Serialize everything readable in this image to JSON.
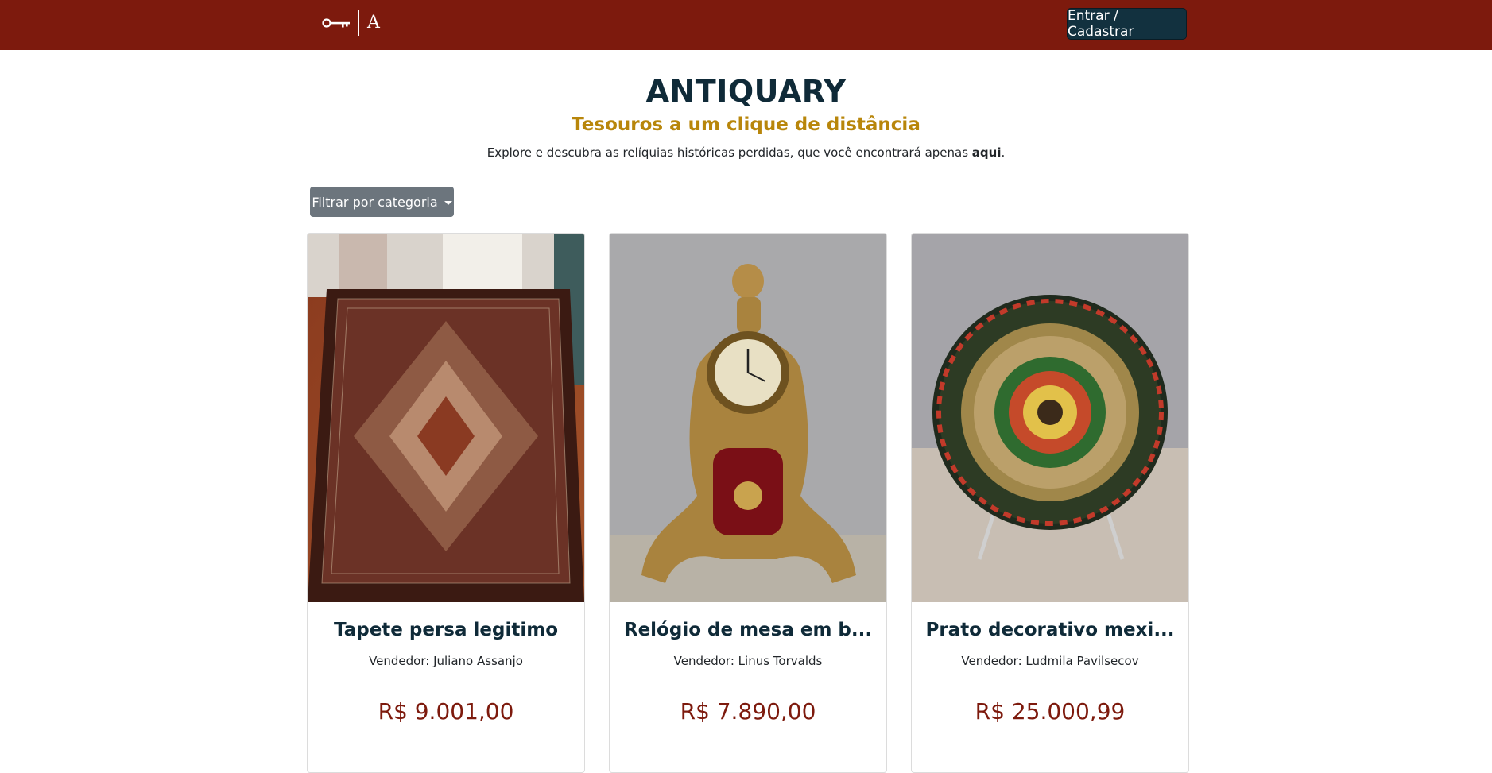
{
  "nav": {
    "brand_letter": "A",
    "login_label": "Entrar / Cadastrar",
    "background_color": "#7d1a0d",
    "icons": [
      "key-icon"
    ]
  },
  "hero": {
    "title": "ANTIQUARY",
    "subtitle": "Tesouros a um clique de distância",
    "description_start": "Explore e descubra as relíquias históricas perdidas, que você encontrará apenas ",
    "description_bold": "aqui",
    "description_end": "."
  },
  "filter": {
    "label": "Filtrar por categoria",
    "icon": "caret-down-icon"
  },
  "products": [
    {
      "title": "Tapete persa legitimo",
      "seller_prefix": "Vendedor: ",
      "seller": "Juliano Assanjo",
      "price": "R$ 9.001,00",
      "image": "persian-rug-photo"
    },
    {
      "title": "Relógio de mesa em b...",
      "seller_prefix": "Vendedor: ",
      "seller": "Linus Torvalds",
      "price": "R$ 7.890,00",
      "image": "brass-table-clock-photo"
    },
    {
      "title": "Prato decorativo mexi...",
      "seller_prefix": "Vendedor: ",
      "seller": "Ludmila Pavilsecov",
      "price": "R$ 25.000,99",
      "image": "mexican-plate-photo"
    }
  ],
  "colors": {
    "primary_dark": "#0f2a38",
    "accent_gold": "#b8860b",
    "price_red": "#7d1a0d",
    "filter_gray": "#6c757d"
  }
}
